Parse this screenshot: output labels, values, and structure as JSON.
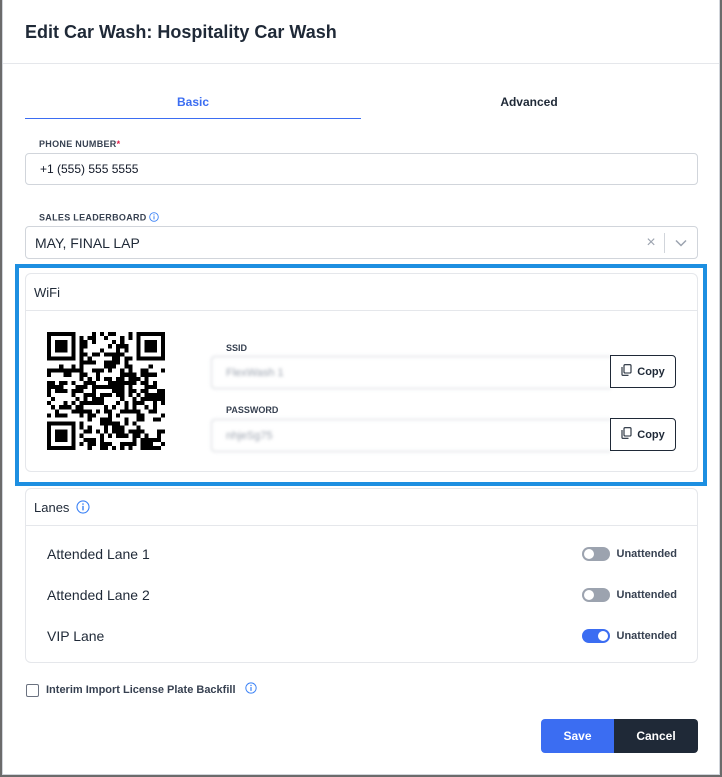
{
  "modal": {
    "title": "Edit Car Wash: Hospitality Car Wash"
  },
  "tabs": [
    {
      "label": "Basic",
      "active": true
    },
    {
      "label": "Advanced",
      "active": false
    }
  ],
  "phone": {
    "label": "PHONE NUMBER",
    "required_mark": "*",
    "value": "+1 (555) 555 5555"
  },
  "leaderboard": {
    "label": "SALES LEADERBOARD",
    "value": "MAY, FINAL LAP",
    "clear_glyph": "×"
  },
  "wifi": {
    "title": "WiFi",
    "ssid_label": "SSID",
    "ssid_value": "FlexWash 1",
    "password_label": "PASSWORD",
    "password_value": "nhjeSg75",
    "copy_label": "Copy",
    "highlight_color": "#1d8fe1"
  },
  "lanes": {
    "title": "Lanes",
    "items": [
      {
        "name": "Attended Lane 1",
        "toggle_label": "Unattended",
        "on": false
      },
      {
        "name": "Attended Lane 2",
        "toggle_label": "Unattended",
        "on": false
      },
      {
        "name": "VIP Lane",
        "toggle_label": "Unattended",
        "on": true
      }
    ]
  },
  "backfill": {
    "label": "Interim Import License Plate Backfill",
    "checked": false
  },
  "actions": {
    "save_label": "Save",
    "cancel_label": "Cancel"
  },
  "colors": {
    "accent": "#3b6df2",
    "dark": "#1f2937"
  }
}
